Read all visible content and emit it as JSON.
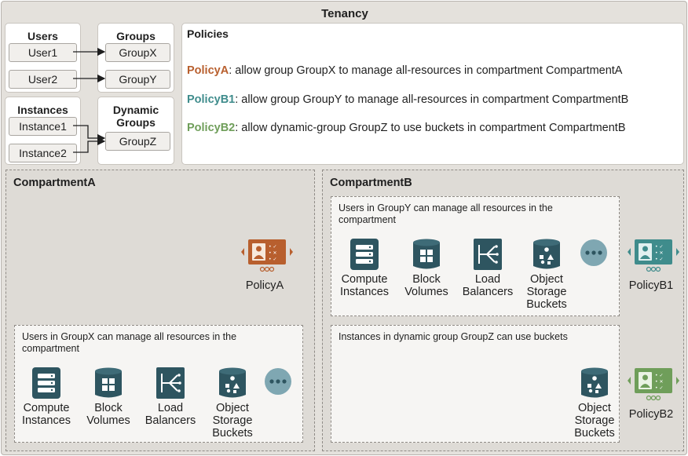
{
  "tenancy": {
    "title": "Tenancy"
  },
  "users": {
    "title": "Users",
    "items": [
      "User1",
      "User2"
    ]
  },
  "groups": {
    "title": "Groups",
    "items": [
      "GroupX",
      "GroupY"
    ]
  },
  "instances": {
    "title": "Instances",
    "items": [
      "Instance1",
      "Instance2"
    ]
  },
  "dynamic_groups": {
    "title_line1": "Dynamic",
    "title_line2": "Groups",
    "items": [
      "GroupZ"
    ]
  },
  "policies": {
    "title": "Policies",
    "rules": [
      {
        "name": "PolicyA",
        "text": ": allow group GroupX to manage all-resources in compartment CompartmentA",
        "color": "#b85f2e"
      },
      {
        "name": "PolicyB1",
        "text": ": allow group GroupY to manage all-resources in compartment CompartmentB",
        "color": "#3f8c8c"
      },
      {
        "name": "PolicyB2",
        "text": ": allow dynamic-group GroupZ to use buckets in compartment CompartmentB",
        "color": "#6f9e5a"
      }
    ]
  },
  "compartment_a": {
    "title": "CompartmentA",
    "policy_label": "PolicyA",
    "group_box": {
      "desc_line1": "Users in GroupX can manage all resources in the",
      "desc_line2": "compartment",
      "services": [
        {
          "line1": "Compute",
          "line2": "Instances",
          "line3": ""
        },
        {
          "line1": "Block",
          "line2": "Volumes",
          "line3": ""
        },
        {
          "line1": "Load",
          "line2": "Balancers",
          "line3": ""
        },
        {
          "line1": "Object",
          "line2": "Storage",
          "line3": "Buckets"
        }
      ]
    }
  },
  "compartment_b": {
    "title": "CompartmentB",
    "policy_b1_label": "PolicyB1",
    "policy_b2_label": "PolicyB2",
    "group_box_y": {
      "desc_line1": "Users in GroupY can manage all resources in the",
      "desc_line2": "compartment",
      "services": [
        {
          "line1": "Compute",
          "line2": "Instances",
          "line3": ""
        },
        {
          "line1": "Block",
          "line2": "Volumes",
          "line3": ""
        },
        {
          "line1": "Load",
          "line2": "Balancers",
          "line3": ""
        },
        {
          "line1": "Object",
          "line2": "Storage",
          "line3": "Buckets"
        }
      ]
    },
    "group_box_z": {
      "desc_line1": "Instances in dynamic group GroupZ can use buckets",
      "service": {
        "line1": "Object",
        "line2": "Storage",
        "line3": "Buckets"
      }
    }
  },
  "colors": {
    "service_icon": "#2e5560",
    "more_icon": "#7fa7b2",
    "policy_a": "#b85f2e",
    "policy_b1": "#3f8c8c",
    "policy_b2": "#6f9e5a"
  },
  "icons": [
    "compute-icon",
    "block-volume-icon",
    "load-balancer-icon",
    "object-storage-icon",
    "more-icon",
    "policy-icon"
  ]
}
